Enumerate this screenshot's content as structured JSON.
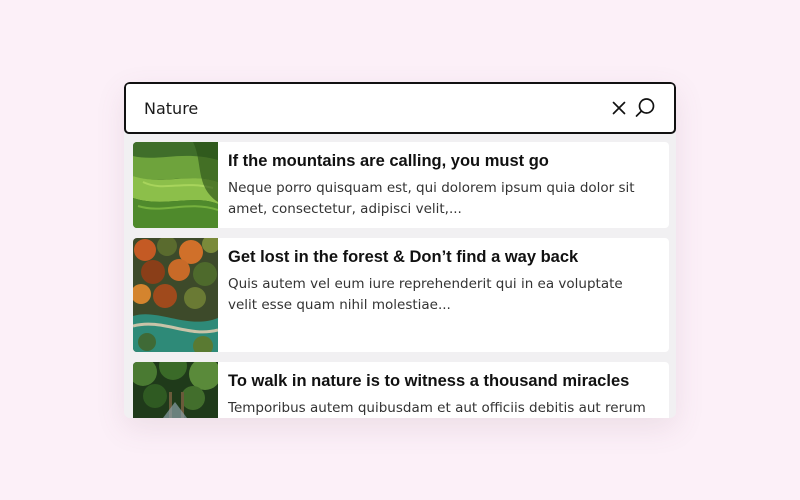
{
  "search": {
    "value": "Nature",
    "clear_icon": "close-icon",
    "search_icon": "search-icon"
  },
  "results": [
    {
      "title": "If the mountains are calling, you must go",
      "description": "Neque porro quisquam est, qui dolorem ipsum quia dolor sit amet, consectetur, adipisci velit,...",
      "image": "green-hills-photo"
    },
    {
      "title": "Get lost in the forest & Don’t find a way back",
      "description": "Quis autem vel eum iure reprehenderit qui in ea voluptate velit esse quam nihil molestiae...",
      "image": "autumn-forest-aerial-photo"
    },
    {
      "title": "To walk in nature is to witness a thousand miracles",
      "description": "Temporibus autem quibusdam et aut officiis debitis aut rerum",
      "image": "forest-bridge-photo"
    }
  ],
  "colors": {
    "background": "#fcf0f8",
    "panel": "#f1f0f2",
    "border": "#111111",
    "title": "#111111",
    "text": "#333333"
  }
}
